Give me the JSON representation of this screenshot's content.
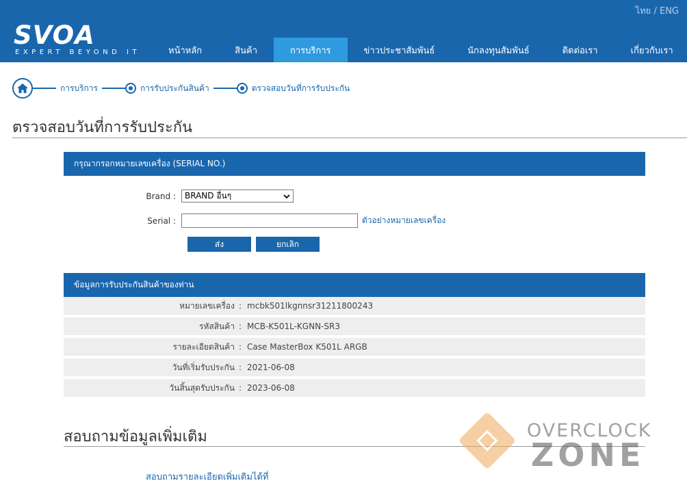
{
  "header": {
    "lang": {
      "thai": "ไทย",
      "sep": "/",
      "eng": "ENG"
    },
    "logo": {
      "word": "SVOA",
      "tagline": "EXPERT BEYOND IT"
    },
    "nav": [
      {
        "label": "หน้าหลัก"
      },
      {
        "label": "สินค้า"
      },
      {
        "label": "การบริการ"
      },
      {
        "label": "ข่าวประชาสัมพันธ์"
      },
      {
        "label": "นักลงทุนสัมพันธ์"
      },
      {
        "label": "ติดต่อเรา"
      },
      {
        "label": "เกี่ยวกับเรา"
      }
    ],
    "active_nav": "การบริการ"
  },
  "breadcrumb": {
    "items": [
      "การบริการ",
      "การรับประกันสินค้า",
      "ตรวจสอบวันที่การรับประกัน"
    ]
  },
  "page_title": "ตรวจสอบวันที่การรับประกัน",
  "form": {
    "header": "กรุณากรอกหมายเลขเครื่อง (SERIAL NO.)",
    "brand_label": "Brand :",
    "brand_value": "BRAND อื่นๆ",
    "serial_label": "Serial :",
    "serial_value": "",
    "example_link": "ตัวอย่างหมายเลขเครื่อง",
    "submit_label": "ส่ง",
    "cancel_label": "ยกเลิก"
  },
  "warranty": {
    "header": "ข้อมูลการรับประกันสินค้าของท่าน",
    "rows": [
      {
        "label": "หมายเลขเครื่อง",
        "value": "mcbk501lkgnnsr31211800243"
      },
      {
        "label": "รหัสสินค้า",
        "value": "MCB-K501L-KGNN-SR3"
      },
      {
        "label": "รายละเอียดสินค้า",
        "value": "Case MasterBox K501L ARGB"
      },
      {
        "label": "วันที่เริ่มรับประกัน",
        "value": "2021-06-08"
      },
      {
        "label": "วันสิ้นสุดรับประกัน",
        "value": "2023-06-08"
      }
    ],
    "sep": ":"
  },
  "more": {
    "title": "สอบถามข้อมูลเพิ่มเติม",
    "link": "สอบถามรายละเอียดเพิ่มเติมได้ที่"
  },
  "watermark": {
    "line1": "OVERCLOCK",
    "line2": "ZONE"
  },
  "colors": {
    "primary": "#1a66ad",
    "active_tab": "#2f9ae0",
    "row_bg": "#eeeeee"
  }
}
